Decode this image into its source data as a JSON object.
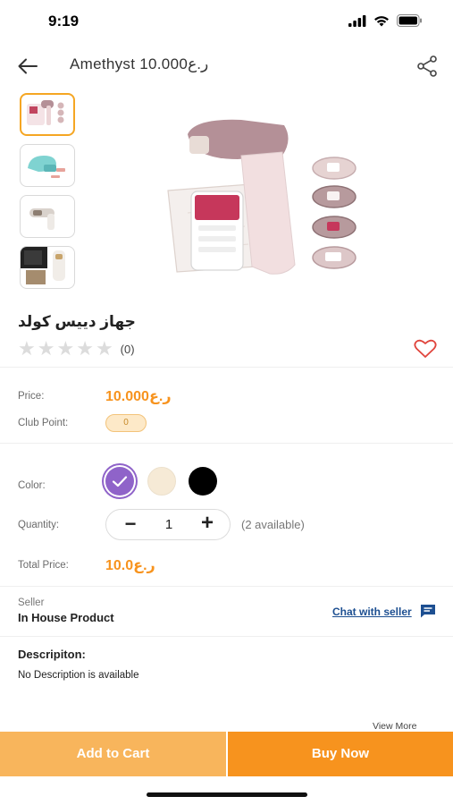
{
  "status_bar": {
    "time": "9:19"
  },
  "header": {
    "title": "Amethyst 10.000ر.ع"
  },
  "thumbnails": [
    {
      "name": "thumb-ipl-kit",
      "active": true
    },
    {
      "name": "thumb-teal-device",
      "active": false
    },
    {
      "name": "thumb-white-device",
      "active": false
    },
    {
      "name": "thumb-black-box",
      "active": false
    }
  ],
  "product": {
    "title": "جهاز دييس كولد",
    "rating_count": "(0)",
    "stars": 5
  },
  "pricing": {
    "price_label": "Price:",
    "price_value": "10.000ر.ع",
    "club_label": "Club Point:",
    "club_value": "0"
  },
  "options": {
    "color_label": "Color:",
    "colors": [
      "#8f63c9",
      "#f6ead6",
      "#000000"
    ],
    "selected_color_index": 0,
    "quantity_label": "Quantity:",
    "quantity_minus": "−",
    "quantity_value": "1",
    "quantity_plus": "+",
    "available_text": "(2 available)",
    "total_label": "Total Price:",
    "total_value": "10.0ر.ع"
  },
  "seller": {
    "label": "Seller",
    "name": "In House Product",
    "chat_label": "Chat with seller"
  },
  "description": {
    "title": "Descripiton:",
    "text": "No Description is available",
    "view_more": "View More"
  },
  "actions": {
    "add_to_cart": "Add to Cart",
    "buy_now": "Buy Now"
  },
  "colors": {
    "accent": "#f7931e",
    "accent_light": "#f8b55c",
    "link": "#1d4f91",
    "heart": "#e0443c"
  }
}
